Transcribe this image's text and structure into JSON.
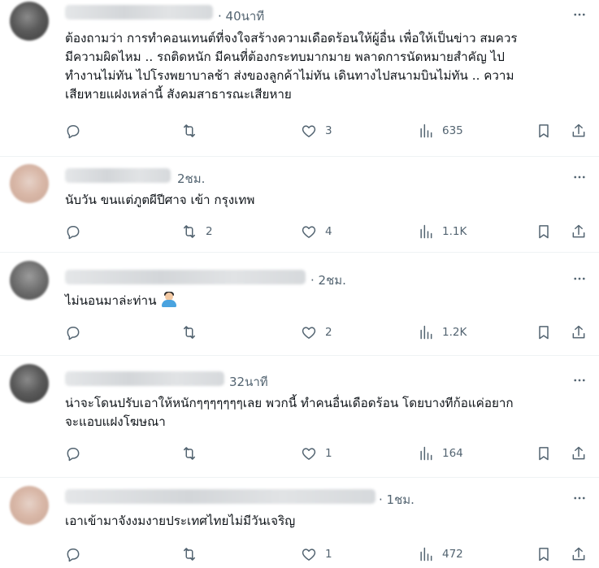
{
  "posts": [
    {
      "timestamp": "· 40นาที",
      "lines": [
        "ต้องถามว่า การทำคอนเทนต์ที่จงใจสร้างความเดือดร้อนให้ผู้อื่น เพื่อให้เป็นข่าว สมควร",
        "มีความผิดไหม .. รถติดหนัก มีคนที่ต้องกระทบมากมาย พลาดการนัดหมายสำคัญ ไป",
        "ทำงานไม่ทัน ไปโรงพยาบาลช้า ส่งของลูกค้าไม่ทัน เดินทางไปสนามบินไม่ทัน .. ความ",
        "เสียหายแฝงเหล่านี้ สังคมสาธารณะเสียหาย"
      ],
      "replies": "",
      "retweets": "",
      "likes": "3",
      "views": "635"
    },
    {
      "timestamp": "2ชม.",
      "lines": [
        "นับวัน ขนแต่ภูตผีปีศาจ เข้า กรุงเทพ"
      ],
      "replies": "",
      "retweets": "2",
      "likes": "4",
      "views": "1.1K"
    },
    {
      "timestamp": "· 2ชม.",
      "lines": [
        "ไม่นอนมาล่ะท่าน"
      ],
      "emoji": "person-shrugging-emoji",
      "replies": "",
      "retweets": "",
      "likes": "2",
      "views": "1.2K"
    },
    {
      "timestamp": "32นาที",
      "lines": [
        "น่าจะโดนปรับเอาให้หนักๆๆๆๆๆๆๆเลย พวกนี้ ทำคนอื่นเดือดร้อน โดยบางทีก้อแค่อยาก",
        "จะแอบแฝงโฆษณา"
      ],
      "replies": "",
      "retweets": "",
      "likes": "1",
      "views": "164"
    },
    {
      "timestamp": "· 1ชม.",
      "lines": [
        "เอาเข้ามาจังงมงายประเทศไทยไม่มีวันเจริญ"
      ],
      "replies": "",
      "retweets": "",
      "likes": "1",
      "views": "472"
    }
  ],
  "icons": {
    "reply": "reply-icon",
    "retweet": "retweet-icon",
    "like": "heart-icon",
    "views": "views-icon",
    "bookmark": "bookmark-icon",
    "share": "share-icon",
    "more": "more-icon"
  },
  "colors": {
    "text": "#0f1419",
    "secondary": "#536471",
    "divider": "#eff3f4"
  }
}
